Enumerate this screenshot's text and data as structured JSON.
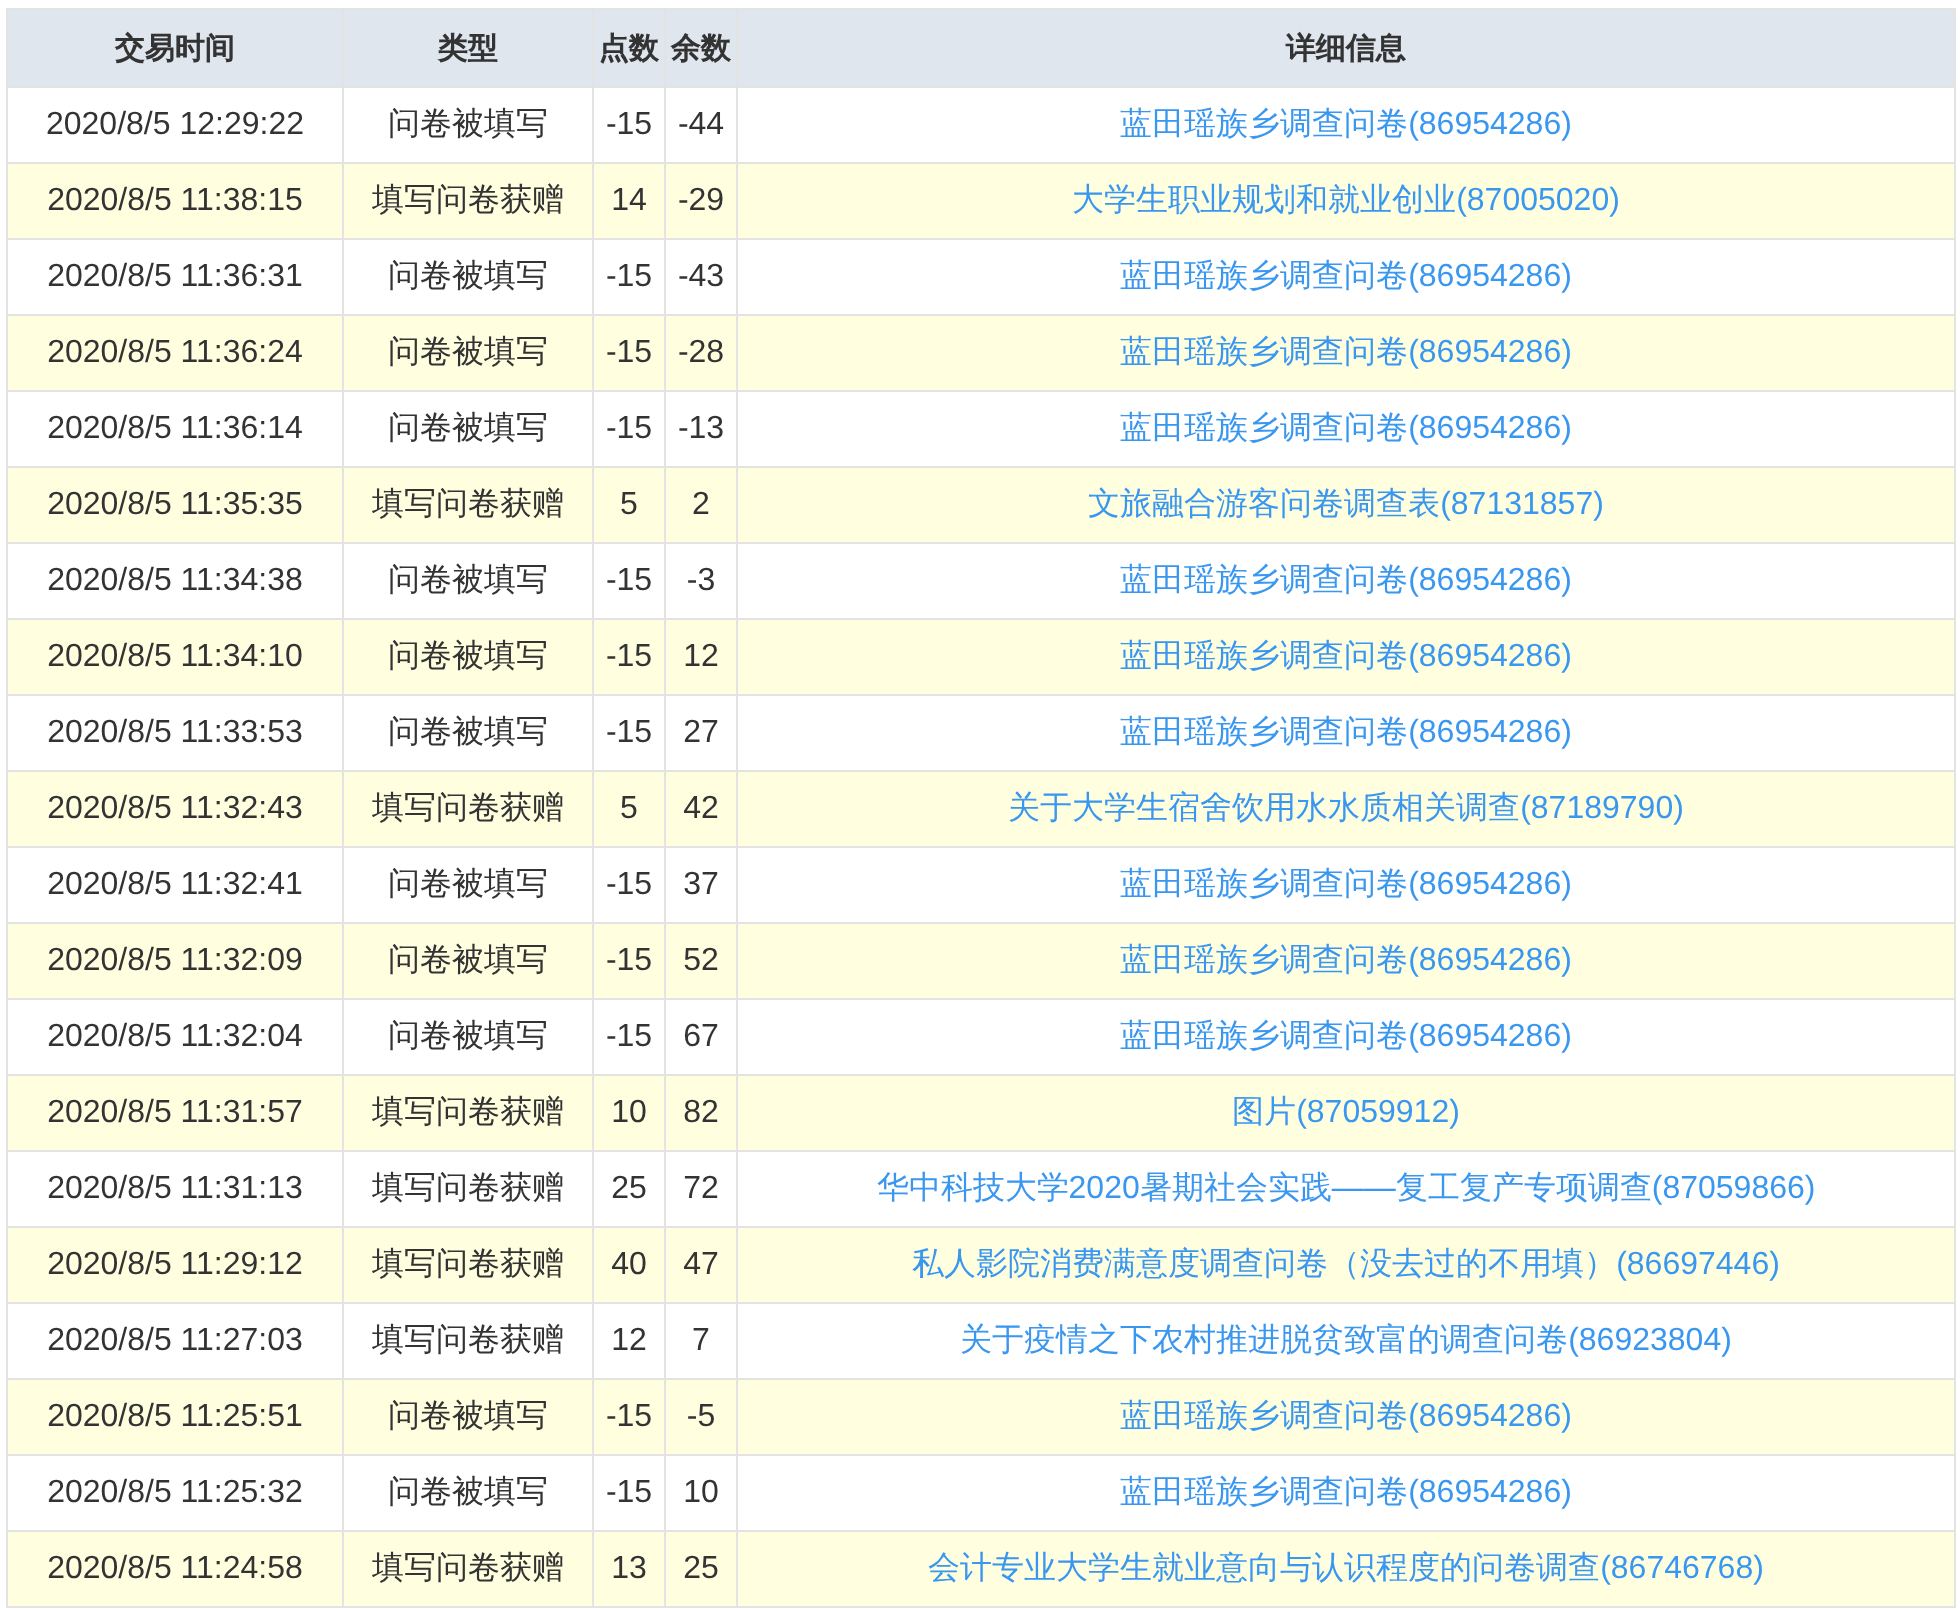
{
  "table": {
    "columns": [
      "交易时间",
      "类型",
      "点数",
      "余数",
      "详细信息"
    ],
    "rows": [
      {
        "time": "2020/8/5 12:29:22",
        "type": "问卷被填写",
        "points": "-15",
        "balance": "-44",
        "detail": "蓝田瑶族乡调查问卷(86954286)"
      },
      {
        "time": "2020/8/5 11:38:15",
        "type": "填写问卷获赠",
        "points": "14",
        "balance": "-29",
        "detail": "大学生职业规划和就业创业(87005020)"
      },
      {
        "time": "2020/8/5 11:36:31",
        "type": "问卷被填写",
        "points": "-15",
        "balance": "-43",
        "detail": "蓝田瑶族乡调查问卷(86954286)"
      },
      {
        "time": "2020/8/5 11:36:24",
        "type": "问卷被填写",
        "points": "-15",
        "balance": "-28",
        "detail": "蓝田瑶族乡调查问卷(86954286)"
      },
      {
        "time": "2020/8/5 11:36:14",
        "type": "问卷被填写",
        "points": "-15",
        "balance": "-13",
        "detail": "蓝田瑶族乡调查问卷(86954286)"
      },
      {
        "time": "2020/8/5 11:35:35",
        "type": "填写问卷获赠",
        "points": "5",
        "balance": "2",
        "detail": "文旅融合游客问卷调查表(87131857)"
      },
      {
        "time": "2020/8/5 11:34:38",
        "type": "问卷被填写",
        "points": "-15",
        "balance": "-3",
        "detail": "蓝田瑶族乡调查问卷(86954286)"
      },
      {
        "time": "2020/8/5 11:34:10",
        "type": "问卷被填写",
        "points": "-15",
        "balance": "12",
        "detail": "蓝田瑶族乡调查问卷(86954286)"
      },
      {
        "time": "2020/8/5 11:33:53",
        "type": "问卷被填写",
        "points": "-15",
        "balance": "27",
        "detail": "蓝田瑶族乡调查问卷(86954286)"
      },
      {
        "time": "2020/8/5 11:32:43",
        "type": "填写问卷获赠",
        "points": "5",
        "balance": "42",
        "detail": "关于大学生宿舍饮用水水质相关调查(87189790)"
      },
      {
        "time": "2020/8/5 11:32:41",
        "type": "问卷被填写",
        "points": "-15",
        "balance": "37",
        "detail": "蓝田瑶族乡调查问卷(86954286)"
      },
      {
        "time": "2020/8/5 11:32:09",
        "type": "问卷被填写",
        "points": "-15",
        "balance": "52",
        "detail": "蓝田瑶族乡调查问卷(86954286)"
      },
      {
        "time": "2020/8/5 11:32:04",
        "type": "问卷被填写",
        "points": "-15",
        "balance": "67",
        "detail": "蓝田瑶族乡调查问卷(86954286)"
      },
      {
        "time": "2020/8/5 11:31:57",
        "type": "填写问卷获赠",
        "points": "10",
        "balance": "82",
        "detail": "图片(87059912)"
      },
      {
        "time": "2020/8/5 11:31:13",
        "type": "填写问卷获赠",
        "points": "25",
        "balance": "72",
        "detail": "华中科技大学2020暑期社会实践——复工复产专项调查(87059866)"
      },
      {
        "time": "2020/8/5 11:29:12",
        "type": "填写问卷获赠",
        "points": "40",
        "balance": "47",
        "detail": "私人影院消费满意度调查问卷（没去过的不用填）(86697446)"
      },
      {
        "time": "2020/8/5 11:27:03",
        "type": "填写问卷获赠",
        "points": "12",
        "balance": "7",
        "detail": "关于疫情之下农村推进脱贫致富的调查问卷(86923804)"
      },
      {
        "time": "2020/8/5 11:25:51",
        "type": "问卷被填写",
        "points": "-15",
        "balance": "-5",
        "detail": "蓝田瑶族乡调查问卷(86954286)"
      },
      {
        "time": "2020/8/5 11:25:32",
        "type": "问卷被填写",
        "points": "-15",
        "balance": "10",
        "detail": "蓝田瑶族乡调查问卷(86954286)"
      },
      {
        "time": "2020/8/5 11:24:58",
        "type": "填写问卷获赠",
        "points": "13",
        "balance": "25",
        "detail": "会计专业大学生就业意向与认识程度的问卷调查(86746768)"
      }
    ]
  }
}
